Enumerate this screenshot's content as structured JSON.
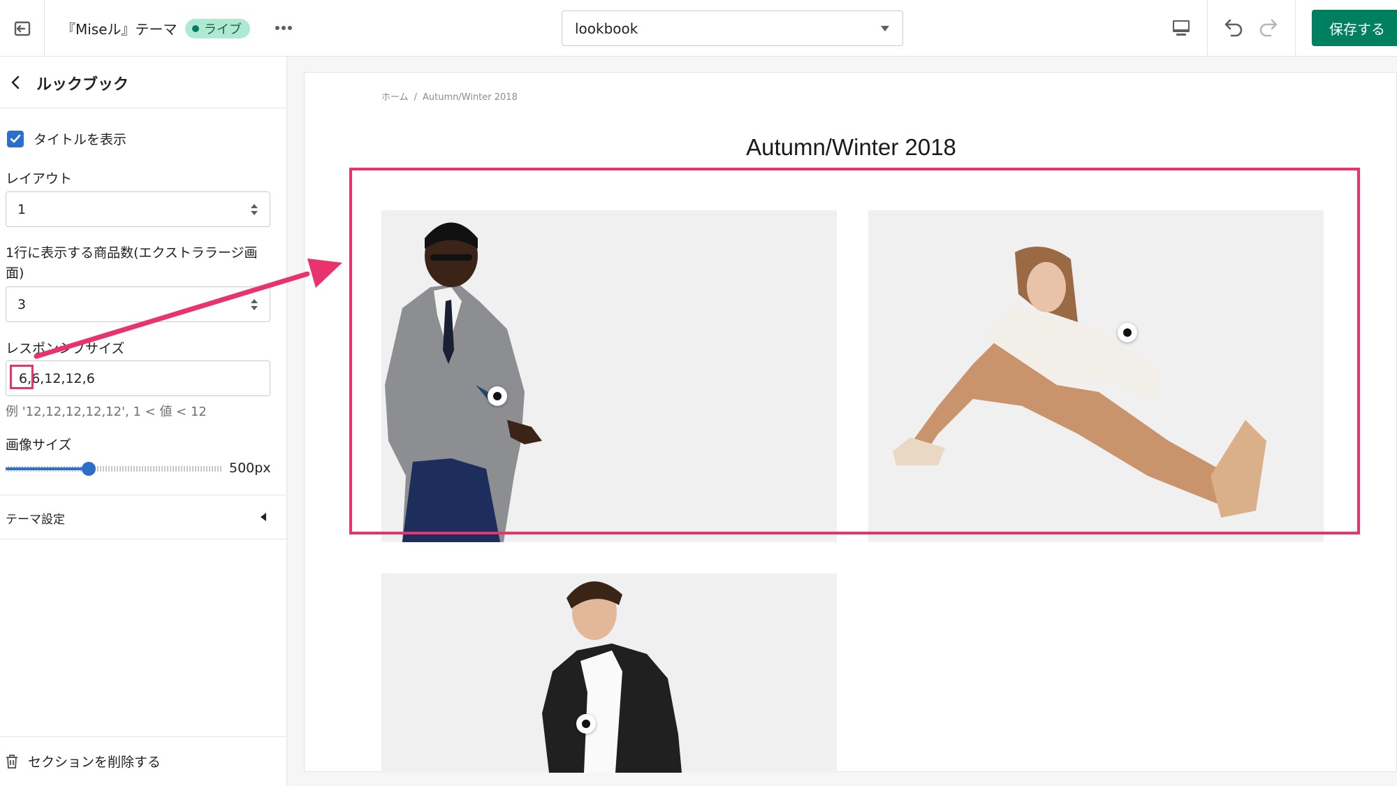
{
  "topbar": {
    "theme_name": "『Miseル』テーマ",
    "live_badge": "ライブ",
    "page_select_value": "lookbook",
    "save_label": "保存する"
  },
  "sidebar": {
    "title": "ルックブック",
    "show_title_checkbox": {
      "label": "タイトルを表示",
      "checked": true
    },
    "layout": {
      "label": "レイアウト",
      "value": "1"
    },
    "items_per_row": {
      "label_line1": "1行に表示する商品数(エクストララージ画",
      "label_line2": "面)",
      "value": "3"
    },
    "responsive_size": {
      "label": "レスポンシブサイズ",
      "value": "6,6,12,12,6",
      "help": "例 '12,12,12,12,12', 1 < 値 < 12"
    },
    "image_size": {
      "label": "画像サイズ",
      "value": "500px",
      "fraction": 0.38
    },
    "theme_settings": "テーマ設定",
    "delete_section": "セクションを削除する"
  },
  "preview": {
    "breadcrumb": {
      "home": "ホーム",
      "separator": "/",
      "current": "Autumn/Winter 2018"
    },
    "lookbook_title": "Autumn/Winter 2018"
  },
  "colors": {
    "primary_green": "#008060",
    "live_badge_bg": "#aee9d1",
    "checkbox_blue": "#2c6ecb",
    "annotation_pink": "#e8336d"
  }
}
